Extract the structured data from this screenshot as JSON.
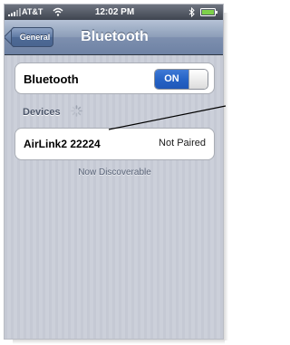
{
  "status_bar": {
    "carrier": "AT&T",
    "time": "12:02 PM",
    "icons": [
      "signal-icon",
      "wifi-icon",
      "bluetooth-icon",
      "battery-icon"
    ]
  },
  "nav": {
    "back_label": "General",
    "title": "Bluetooth"
  },
  "bluetooth": {
    "label": "Bluetooth",
    "toggle_value": "ON"
  },
  "devices": {
    "header": "Devices",
    "items": [
      {
        "name": "AirLink2 22224",
        "status": "Not Paired"
      }
    ]
  },
  "discoverable_text": "Now Discoverable",
  "colors": {
    "toggle_on": "#2663c6",
    "nav_bar": "#8c9db8",
    "background": "#c8ccd6"
  }
}
